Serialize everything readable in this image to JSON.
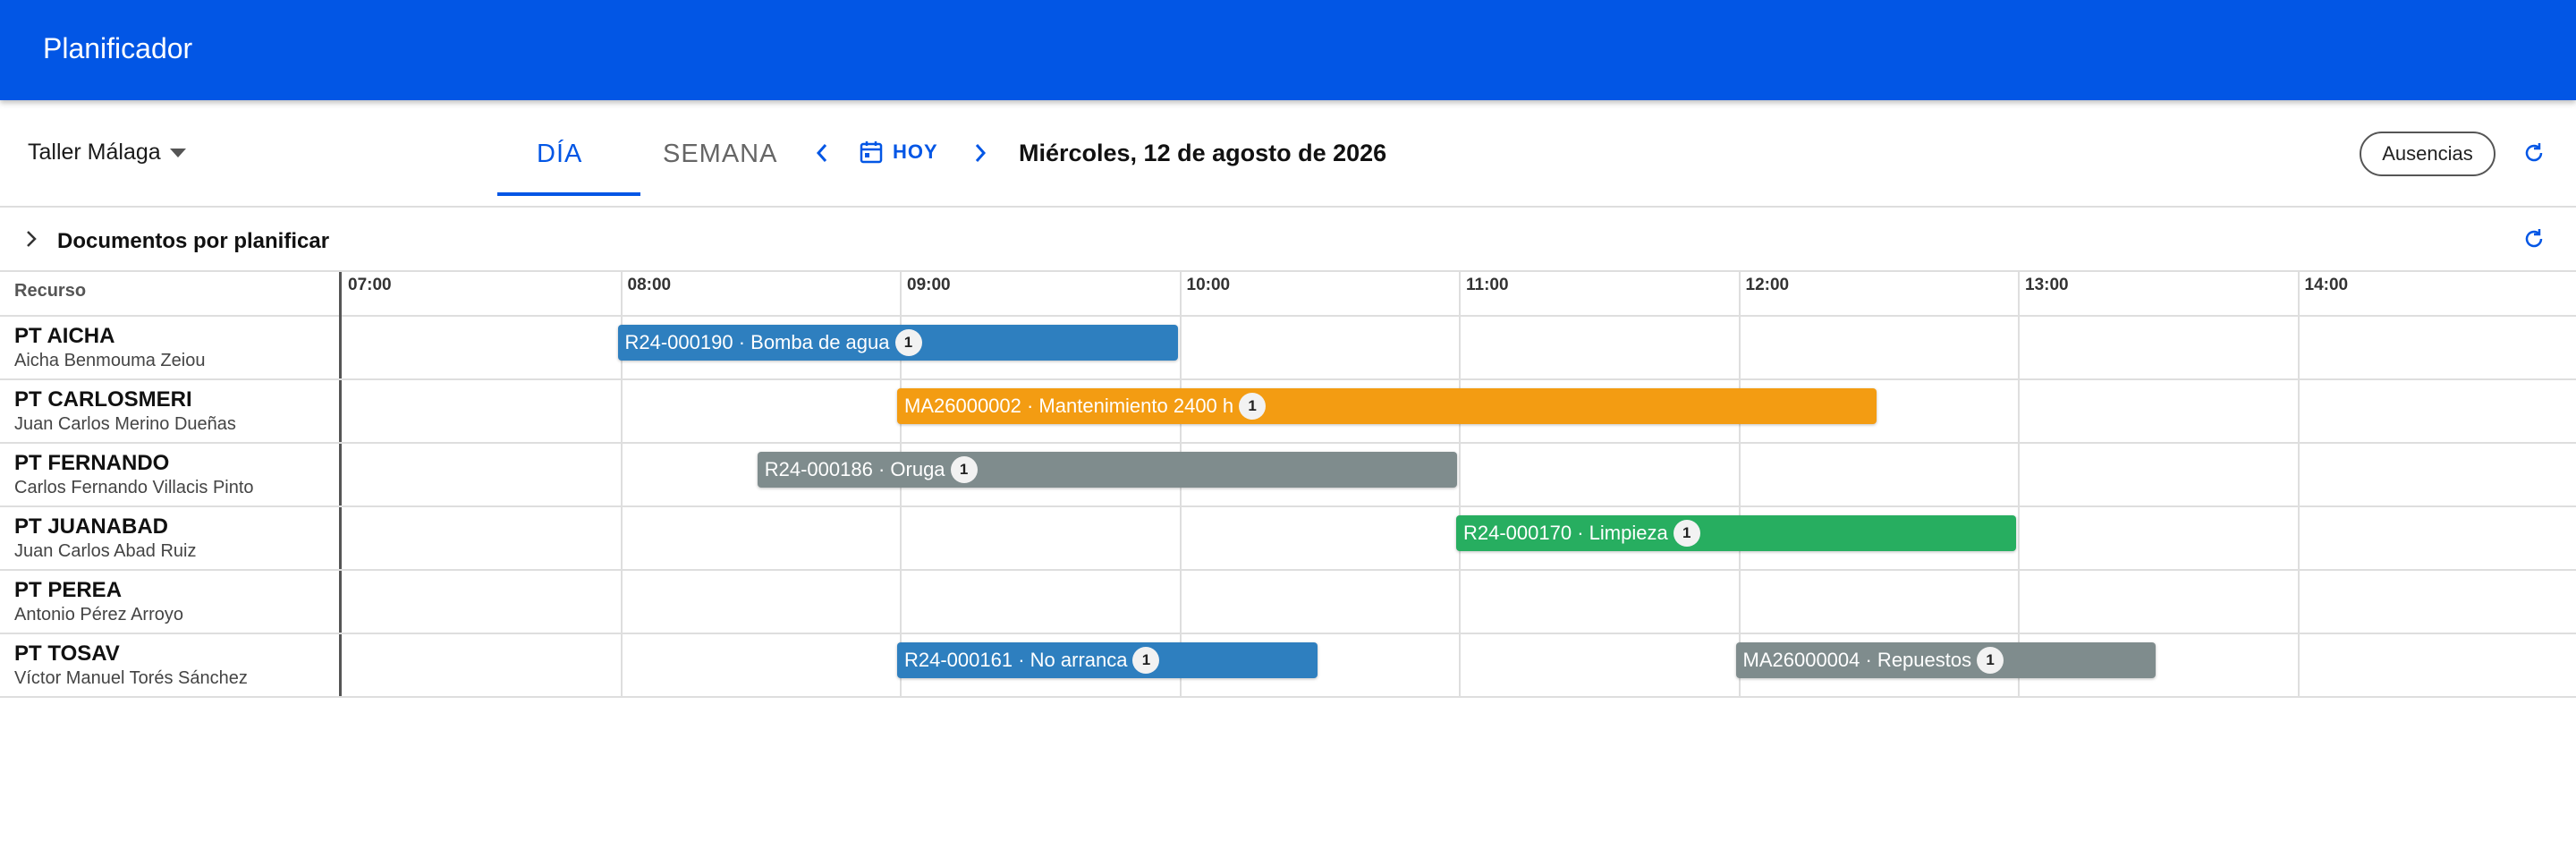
{
  "appbar": {
    "title": "Planificador"
  },
  "toolbar": {
    "workshop": "Taller Málaga",
    "tabs": {
      "day": "DÍA",
      "week": "SEMANA"
    },
    "today": "HOY",
    "date_title": "Miércoles, 12 de agosto de 2026",
    "absences": "Ausencias"
  },
  "docs": {
    "title": "Documentos por planificar"
  },
  "grid": {
    "resource_header": "Recurso",
    "hours": [
      "07:00",
      "08:00",
      "09:00",
      "10:00",
      "11:00",
      "12:00",
      "13:00",
      "14:00"
    ],
    "resources": [
      {
        "code": "PT AICHA",
        "name": "Aicha Benmouma Zeiou"
      },
      {
        "code": "PT CARLOSMERI",
        "name": "Juan Carlos Merino Dueñas"
      },
      {
        "code": "PT FERNANDO",
        "name": "Carlos Fernando Villacis Pinto"
      },
      {
        "code": "PT JUANABAD",
        "name": "Juan Carlos Abad Ruiz"
      },
      {
        "code": "PT PEREA",
        "name": "Antonio Pérez Arroyo"
      },
      {
        "code": "PT TOSAV",
        "name": "Víctor Manuel Torés Sánchez"
      }
    ],
    "tasks": [
      {
        "row": 0,
        "start": "08:00",
        "end": "10:00",
        "label": "R24-000190 · Bomba de agua",
        "count": "1",
        "color": "#2e7fbf"
      },
      {
        "row": 1,
        "start": "09:00",
        "end": "12:30",
        "label": "MA26000002 · Mantenimiento 2400 h",
        "count": "1",
        "color": "#f39c12"
      },
      {
        "row": 2,
        "start": "08:30",
        "end": "11:00",
        "label": "R24-000186 · Oruga",
        "count": "1",
        "color": "#7f8c8d"
      },
      {
        "row": 3,
        "start": "11:00",
        "end": "13:00",
        "label": "R24-000170 · Limpieza",
        "count": "1",
        "color": "#27ae60"
      },
      {
        "row": 5,
        "start": "09:00",
        "end": "10:30",
        "label": "R24-000161 · No arranca",
        "count": "1",
        "color": "#2e7fbf"
      },
      {
        "row": 5,
        "start": "12:00",
        "end": "13:30",
        "label": "MA26000004 · Repuestos",
        "count": "1",
        "color": "#7f8c8d"
      }
    ]
  },
  "colors": {
    "primary": "#0256e5",
    "blue_task": "#2e7fbf",
    "orange_task": "#f39c12",
    "grey_task": "#7f8c8d",
    "green_task": "#27ae60"
  },
  "icons": [
    "chevron-left-icon",
    "calendar-icon",
    "chevron-right-icon",
    "refresh-icon",
    "chevron-right-icon",
    "caret-down-icon"
  ]
}
